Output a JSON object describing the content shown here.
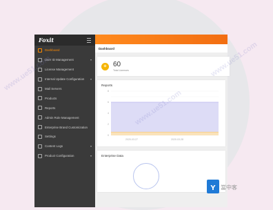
{
  "brand": {
    "logo": "Foxit"
  },
  "sidebar": {
    "items": [
      {
        "label": "Dashboard",
        "active": true,
        "caret": false
      },
      {
        "label": "User ID Management",
        "active": false,
        "caret": true
      },
      {
        "label": "License Management",
        "active": false,
        "caret": false
      },
      {
        "label": "Internal Update Configuration",
        "active": false,
        "caret": true
      },
      {
        "label": "Mail Servers",
        "active": false,
        "caret": false
      },
      {
        "label": "Products",
        "active": false,
        "caret": false
      },
      {
        "label": "Reports",
        "active": false,
        "caret": false
      },
      {
        "label": "Admin Role Management",
        "active": false,
        "caret": false
      },
      {
        "label": "Enterprise Brand Customization",
        "active": false,
        "caret": false
      },
      {
        "label": "Settings",
        "active": false,
        "caret": false
      },
      {
        "label": "Content Logs",
        "active": false,
        "caret": true
      },
      {
        "label": "Product Configuration",
        "active": false,
        "caret": true
      }
    ]
  },
  "main": {
    "page_title": "Dashboard",
    "stat": {
      "value": "60",
      "label": "Total Licenses",
      "icon": "coin-icon"
    },
    "reports_title": "Reports",
    "enterprise_title": "Enterprise Data"
  },
  "chart_data": {
    "type": "area",
    "x": [
      "2020-03-27",
      "2020-03-28"
    ],
    "ylim": [
      0,
      8
    ],
    "series": [
      {
        "values": [
          6,
          6
        ]
      },
      {
        "values": [
          0.6,
          0.6
        ]
      }
    ],
    "grid": true
  },
  "colors": {
    "accent": "#ff8a00",
    "sidebar": "#3a3a3a",
    "area_top": "#d9d8f5",
    "area_bottom": "#fde2b3"
  },
  "watermark": {
    "text": "www.ue51.com",
    "badge_text": "當中客"
  }
}
